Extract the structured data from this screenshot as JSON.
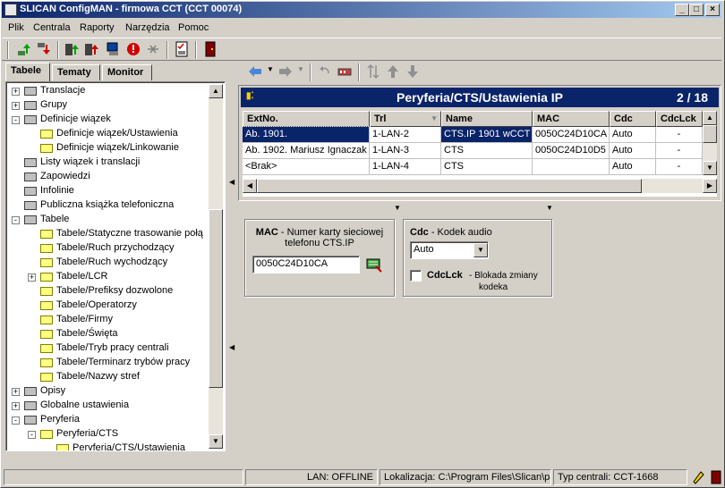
{
  "window": {
    "title": "SLICAN ConfigMAN - firmowa CCT (CCT 00074)",
    "controls": [
      "_",
      "□",
      "×"
    ]
  },
  "menu": [
    "Plik",
    "Centrala",
    "Raporty",
    "Narzędzia",
    "Pomoc"
  ],
  "tabs": [
    "Tabele",
    "Tematy",
    "Monitor"
  ],
  "tree": [
    {
      "label": "Translacje",
      "level": 0,
      "expander": "+",
      "icon": "antenna-icon"
    },
    {
      "label": "Grupy",
      "level": 0,
      "expander": "+",
      "icon": "group-icon"
    },
    {
      "label": "Definicje wiązek",
      "level": 0,
      "expander": "-",
      "icon": "bundle-icon"
    },
    {
      "label": "Definicje wiązek/Ustawienia",
      "level": 1,
      "expander": "",
      "icon": "folder-icon"
    },
    {
      "label": "Definicje wiązek/Linkowanie",
      "level": 1,
      "expander": "",
      "icon": "folder-icon"
    },
    {
      "label": "Listy wiązek i translacji",
      "level": 0,
      "expander": "",
      "icon": "list-icon"
    },
    {
      "label": "Zapowiedzi",
      "level": 0,
      "expander": "",
      "icon": "speaker-icon"
    },
    {
      "label": "Infolinie",
      "level": 0,
      "expander": "",
      "icon": "info-line-icon"
    },
    {
      "label": "Publiczna książka telefoniczna",
      "level": 0,
      "expander": "",
      "icon": "phonebook-icon"
    },
    {
      "label": "Tabele",
      "level": 0,
      "expander": "-",
      "icon": "table-icon"
    },
    {
      "label": "Tabele/Statyczne trasowanie połą",
      "level": 1,
      "expander": "",
      "icon": "folder-icon"
    },
    {
      "label": "Tabele/Ruch przychodzący",
      "level": 1,
      "expander": "",
      "icon": "folder-icon"
    },
    {
      "label": "Tabele/Ruch wychodzący",
      "level": 1,
      "expander": "",
      "icon": "folder-icon"
    },
    {
      "label": "Tabele/LCR",
      "level": 1,
      "expander": "+",
      "icon": "folder-icon"
    },
    {
      "label": "Tabele/Prefiksy dozwolone",
      "level": 1,
      "expander": "",
      "icon": "folder-icon"
    },
    {
      "label": "Tabele/Operatorzy",
      "level": 1,
      "expander": "",
      "icon": "folder-icon"
    },
    {
      "label": "Tabele/Firmy",
      "level": 1,
      "expander": "",
      "icon": "folder-icon"
    },
    {
      "label": "Tabele/Święta",
      "level": 1,
      "expander": "",
      "icon": "folder-icon"
    },
    {
      "label": "Tabele/Tryb pracy centrali",
      "level": 1,
      "expander": "",
      "icon": "folder-icon"
    },
    {
      "label": "Tabele/Terminarz trybów pracy",
      "level": 1,
      "expander": "",
      "icon": "folder-icon"
    },
    {
      "label": "Tabele/Nazwy stref",
      "level": 1,
      "expander": "",
      "icon": "folder-icon"
    },
    {
      "label": "Opisy",
      "level": 0,
      "expander": "+",
      "icon": "labels-icon"
    },
    {
      "label": "Globalne ustawienia",
      "level": 0,
      "expander": "+",
      "icon": "globe-icon"
    },
    {
      "label": "Peryferia",
      "level": 0,
      "expander": "-",
      "icon": "peripherals-icon"
    },
    {
      "label": "Peryferia/CTS",
      "level": 1,
      "expander": "-",
      "icon": "folder-icon"
    },
    {
      "label": "Peryferia/CTS/Ustawienia",
      "level": 2,
      "expander": "",
      "icon": "folder-icon"
    }
  ],
  "panel": {
    "title": "Peryferia/CTS/Ustawienia IP",
    "pager": "2 / 18",
    "columns": [
      "ExtNo.",
      "Trl",
      "Name",
      "MAC",
      "Cdc",
      "CdcLck"
    ],
    "rows": [
      [
        "Ab. 1901.",
        "1-LAN-2",
        "CTS.IP 1901 wCCT",
        "0050C24D10CA",
        "Auto",
        "-"
      ],
      [
        "Ab. 1902. Mariusz Ignaczak",
        "1-LAN-3",
        "CTS",
        "0050C24D10D5",
        "Auto",
        "-"
      ],
      [
        "<Brak>",
        "1-LAN-4",
        "CTS",
        "",
        "Auto",
        "-"
      ]
    ]
  },
  "mac_group": {
    "key": "MAC",
    "desc_line1": " - Numer karty sieciowej",
    "desc_line2": "telefonu CTS.IP",
    "value": "0050C24D10CA"
  },
  "cdc_group": {
    "key": "Cdc",
    "desc": " - Kodek audio",
    "select_value": "Auto",
    "lck_key": "CdcLck",
    "lck_desc_line1": "-   Blokada zmiany",
    "lck_desc_line2": "kodeka"
  },
  "status": {
    "lan": "LAN: OFFLINE",
    "location": "Lokalizacja: C:\\Program Files\\Slican\\pa",
    "type": "Typ centrali: CCT-1668"
  }
}
